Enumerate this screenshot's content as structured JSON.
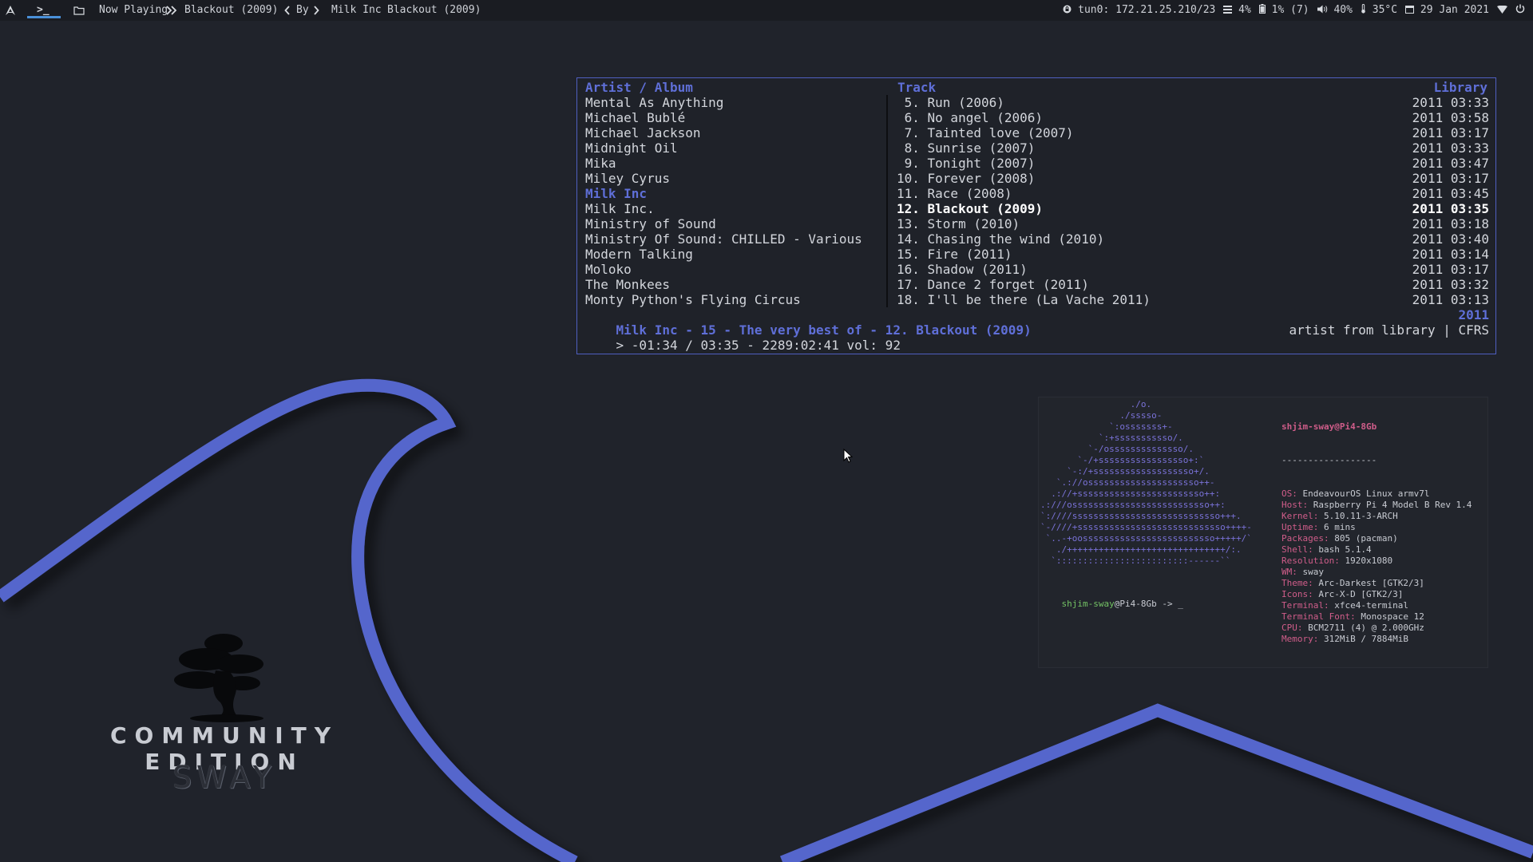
{
  "topbar": {
    "launcher_icon": "arch-logo-icon",
    "terminal_icon": "terminal-icon",
    "folder_icon": "folder-icon",
    "now_playing_label": "Now Playing",
    "now_playing_track": "Blackout (2009)",
    "by_label": "By",
    "artist": "Milk Inc",
    "track_title": "Blackout (2009)"
  },
  "status": {
    "vpn": "tun0: 172.21.25.210/23",
    "cpu": "4%",
    "disk": "1% (7)",
    "volume": "40%",
    "temp": "35°C",
    "date": "29 Jan 2021"
  },
  "wallpaper": {
    "edition_text": "COMMUNITY EDITION",
    "wm_text": "SWAY",
    "accent": "#5566cc"
  },
  "cmus": {
    "header_artist": "Artist / Album",
    "header_track": "Track",
    "header_library": "Library",
    "artists": [
      "Mental As Anything",
      "Michael Bublé",
      "Michael Jackson",
      "Midnight Oil",
      "Mika",
      "Miley Cyrus",
      "Milk Inc",
      "Milk Inc.",
      "Ministry of Sound",
      "Ministry Of Sound: CHILLED - Various",
      "Modern Talking",
      "Moloko",
      "The Monkees",
      "Monty Python's Flying Circus"
    ],
    "selected_artist_index": 6,
    "tracks": [
      {
        "title": " 5. Run (2006)",
        "meta": "2011 03:33"
      },
      {
        "title": " 6. No angel (2006)",
        "meta": "2011 03:58"
      },
      {
        "title": " 7. Tainted love (2007)",
        "meta": "2011 03:17"
      },
      {
        "title": " 8. Sunrise (2007)",
        "meta": "2011 03:33"
      },
      {
        "title": " 9. Tonight (2007)",
        "meta": "2011 03:47"
      },
      {
        "title": "10. Forever (2008)",
        "meta": "2011 03:17"
      },
      {
        "title": "11. Race (2008)",
        "meta": "2011 03:45"
      },
      {
        "title": "12. Blackout (2009)",
        "meta": "2011 03:35"
      },
      {
        "title": "13. Storm (2010)",
        "meta": "2011 03:18"
      },
      {
        "title": "14. Chasing the wind (2010)",
        "meta": "2011 03:40"
      },
      {
        "title": "15. Fire (2011)",
        "meta": "2011 03:14"
      },
      {
        "title": "16. Shadow (2011)",
        "meta": "2011 03:17"
      },
      {
        "title": "17. Dance 2 forget (2011)",
        "meta": "2011 03:32"
      },
      {
        "title": "18. I'll be there (La Vache 2011)",
        "meta": "2011 03:13"
      }
    ],
    "playing_track_index": 7,
    "now_playing_line": "Milk Inc - 15 - The very best of - 12. Blackout (2009)",
    "now_playing_year": "2011",
    "position_line": "> -01:34 / 03:35 - 2289:02:41 vol: 92",
    "mode_line": "artist from library | CFRS"
  },
  "neofetch": {
    "ascii": [
      "                 ./o.",
      "               ./sssso-",
      "             `:osssssss+-",
      "           `:+sssssssssso/.",
      "         `-/ossssssssssssso/.",
      "       `-/+sssssssssssssssso+:`",
      "     `-:/+sssssssssssssssssso+/.",
      "   `.://osssssssssssssssssssso++-",
      "  .://+ssssssssssssssssssssssso++:",
      ".:///ossssssssssssssssssssssssso++:",
      "`:////ssssssssssssssssssssssssssso+++.",
      "`-////+ssssssssssssssssssssssssssso++++-",
      " `..-+oosssssssssssssssssssssssso+++++/`",
      "   ./++++++++++++++++++++++++++++++/:.",
      "  `:::::::::::::::::::::::::------``"
    ],
    "title": "shjim-sway@Pi4-8Gb",
    "separator": "------------------",
    "info": [
      {
        "k": "OS",
        "v": "EndeavourOS Linux armv7l"
      },
      {
        "k": "Host",
        "v": "Raspberry Pi 4 Model B Rev 1.4"
      },
      {
        "k": "Kernel",
        "v": "5.10.11-3-ARCH"
      },
      {
        "k": "Uptime",
        "v": "6 mins"
      },
      {
        "k": "Packages",
        "v": "805 (pacman)"
      },
      {
        "k": "Shell",
        "v": "bash 5.1.4"
      },
      {
        "k": "Resolution",
        "v": "1920x1080"
      },
      {
        "k": "WM",
        "v": "sway"
      },
      {
        "k": "Theme",
        "v": "Arc-Darkest [GTK2/3]"
      },
      {
        "k": "Icons",
        "v": "Arc-X-D [GTK2/3]"
      },
      {
        "k": "Terminal",
        "v": "xfce4-terminal"
      },
      {
        "k": "Terminal Font",
        "v": "Monospace 12"
      },
      {
        "k": "CPU",
        "v": "BCM2711 (4) @ 2.000GHz"
      },
      {
        "k": "Memory",
        "v": "312MiB / 7884MiB"
      }
    ],
    "prompt_user": "shjim-sway",
    "prompt_host": "@Pi4-8Gb -> _"
  }
}
